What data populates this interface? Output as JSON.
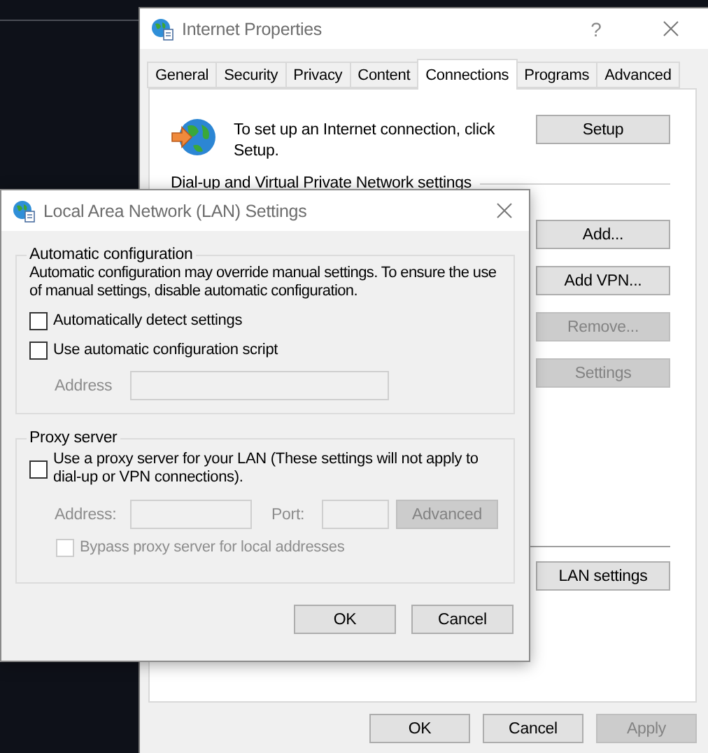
{
  "internet_properties": {
    "title": "Internet Properties",
    "help": "?",
    "tabs": [
      {
        "label": "General",
        "selected": false
      },
      {
        "label": "Security",
        "selected": false
      },
      {
        "label": "Privacy",
        "selected": false
      },
      {
        "label": "Content",
        "selected": false
      },
      {
        "label": "Connections",
        "selected": true
      },
      {
        "label": "Programs",
        "selected": false
      },
      {
        "label": "Advanced",
        "selected": false
      }
    ],
    "setup_text": "To set up an Internet connection, click Setup.",
    "setup_button": {
      "label": "Setup",
      "disabled": false
    },
    "dialup_heading": "Dial-up and Virtual Private Network settings",
    "side_buttons": [
      {
        "label": "Add...",
        "disabled": false
      },
      {
        "label": "Add VPN...",
        "disabled": false
      },
      {
        "label": "Remove...",
        "disabled": true
      },
      {
        "label": "Settings",
        "disabled": true
      }
    ],
    "lan_button": {
      "label": "LAN settings",
      "disabled": false
    },
    "footer_buttons": [
      {
        "label": "OK",
        "disabled": false
      },
      {
        "label": "Cancel",
        "disabled": false
      },
      {
        "label": "Apply",
        "disabled": true
      }
    ]
  },
  "lan_dialog": {
    "title": "Local Area Network (LAN) Settings",
    "automatic": {
      "legend": "Automatic configuration",
      "note": "Automatic configuration may override manual settings.  To ensure the use of manual settings, disable automatic configuration.",
      "options": [
        {
          "label": "Automatically detect settings",
          "checked": false
        },
        {
          "label": "Use automatic configuration script",
          "checked": false
        }
      ],
      "address": {
        "label": "Address",
        "disabled": true
      }
    },
    "proxy": {
      "legend": "Proxy server",
      "option": {
        "label": "Use a proxy server for your LAN (These settings will not apply to dial-up or VPN connections).",
        "checked": false
      },
      "address": {
        "label": "Address:",
        "disabled": true
      },
      "port": {
        "label": "Port:",
        "disabled": true
      },
      "advanced": {
        "label": "Advanced",
        "disabled": true
      },
      "bypass": {
        "label": "Bypass proxy server for local addresses",
        "checked": false,
        "disabled": true
      }
    },
    "buttons": [
      {
        "label": "OK",
        "disabled": false
      },
      {
        "label": "Cancel",
        "disabled": false
      }
    ]
  }
}
